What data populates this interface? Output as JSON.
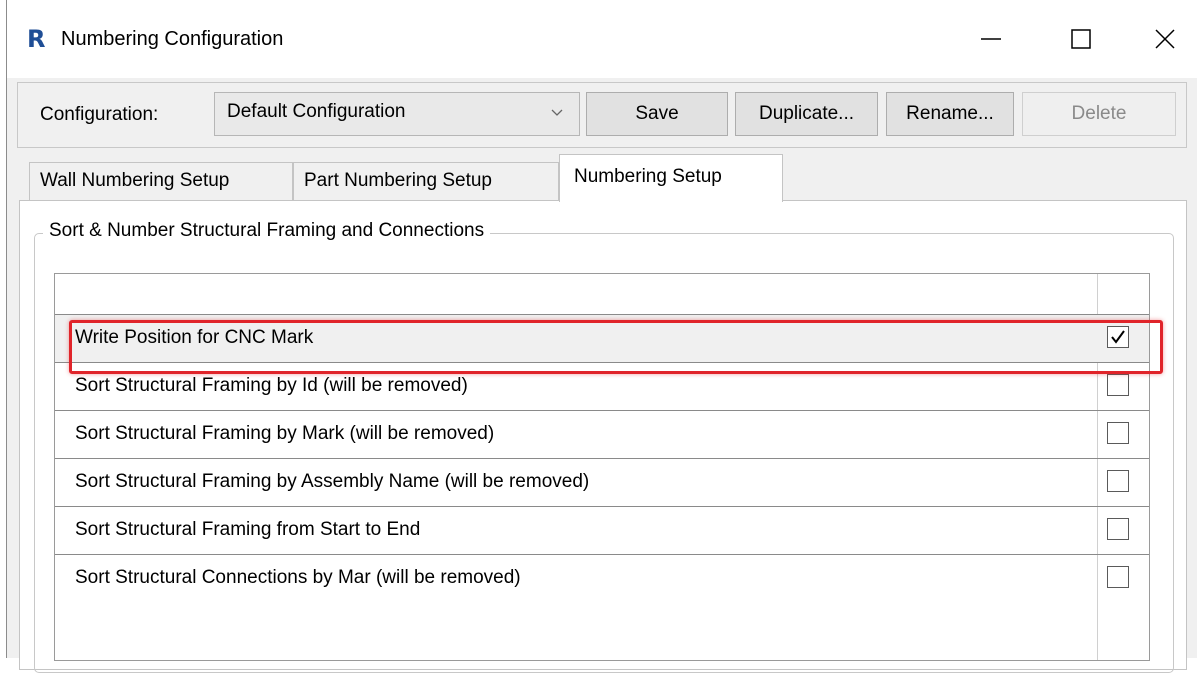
{
  "window": {
    "title": "Numbering Configuration",
    "app_icon": "R"
  },
  "toolbar": {
    "config_label": "Configuration:",
    "config_value": "Default Configuration",
    "save_label": "Save",
    "duplicate_label": "Duplicate...",
    "rename_label": "Rename...",
    "delete_label": "Delete"
  },
  "tabs": [
    {
      "label": "Wall Numbering Setup"
    },
    {
      "label": "Part Numbering Setup"
    },
    {
      "label": "Numbering Setup",
      "active": true
    }
  ],
  "group": {
    "title": "Sort & Number Structural Framing and Connections"
  },
  "rows": [
    {
      "label": "Write Position for CNC Mark",
      "checked": true
    },
    {
      "label": "Sort Structural Framing by Id (will be removed)",
      "checked": false
    },
    {
      "label": "Sort Structural Framing by Mark (will be removed)",
      "checked": false
    },
    {
      "label": "Sort Structural Framing by Assembly Name (will be removed)",
      "checked": false
    },
    {
      "label": "Sort Structural Framing from Start to End",
      "checked": false
    },
    {
      "label": "Sort Structural Connections by Mar (will be removed)",
      "checked": false
    }
  ],
  "colors": {
    "highlight": "#e0242a",
    "app_icon": "#1f4e96"
  }
}
